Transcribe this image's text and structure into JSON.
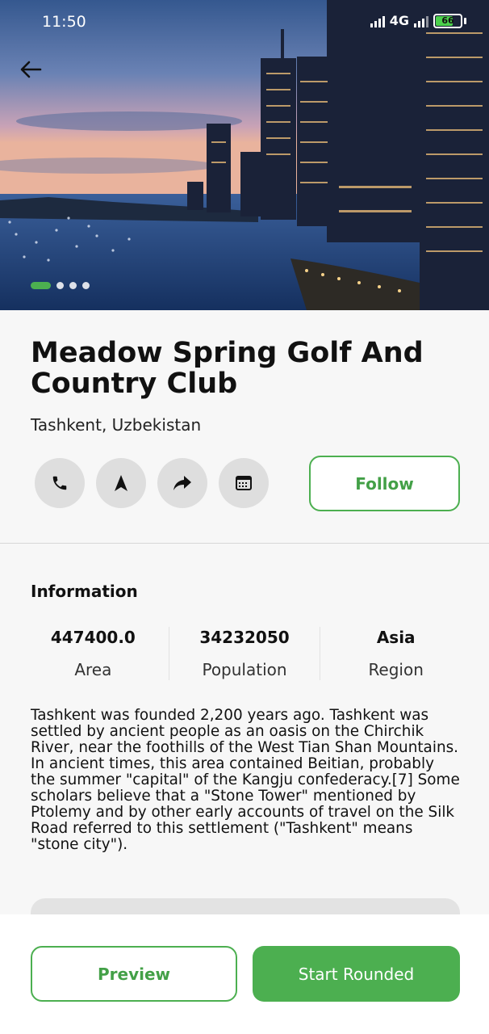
{
  "status_bar": {
    "time": "11:50",
    "network": "4G",
    "battery": "66"
  },
  "hero": {
    "slide_count": 4,
    "active_slide": 1
  },
  "place": {
    "title": "Meadow Spring Golf And Country Club",
    "location": "Tashkent, Uzbekistan"
  },
  "actions": {
    "icons": [
      "phone-icon",
      "navigation-icon",
      "share-icon",
      "calendar-icon"
    ],
    "follow_label": "Follow"
  },
  "information": {
    "heading": "Information",
    "stats": [
      {
        "value": "447400.0",
        "label": "Area"
      },
      {
        "value": "34232050",
        "label": "Population"
      },
      {
        "value": "Asia",
        "label": "Region"
      }
    ],
    "description": "Tashkent was founded 2,200 years ago. Tashkent was settled by ancient people as an oasis on the Chirchik River, near the foothills of the West Tian Shan Mountains. In ancient times, this area contained Beitian, probably the summer \"capital\" of the Kangju confederacy.[7] Some scholars believe that a \"Stone Tower\" mentioned by Ptolemy and by other early accounts of travel on the Silk Road referred to this settlement (\"Tashkent\" means \"stone city\")."
  },
  "footer": {
    "preview_label": "Preview",
    "start_label": "Start Rounded"
  },
  "colors": {
    "accent": "#4caf50",
    "accent_text": "#43a047",
    "icon_bg": "#dedede"
  }
}
